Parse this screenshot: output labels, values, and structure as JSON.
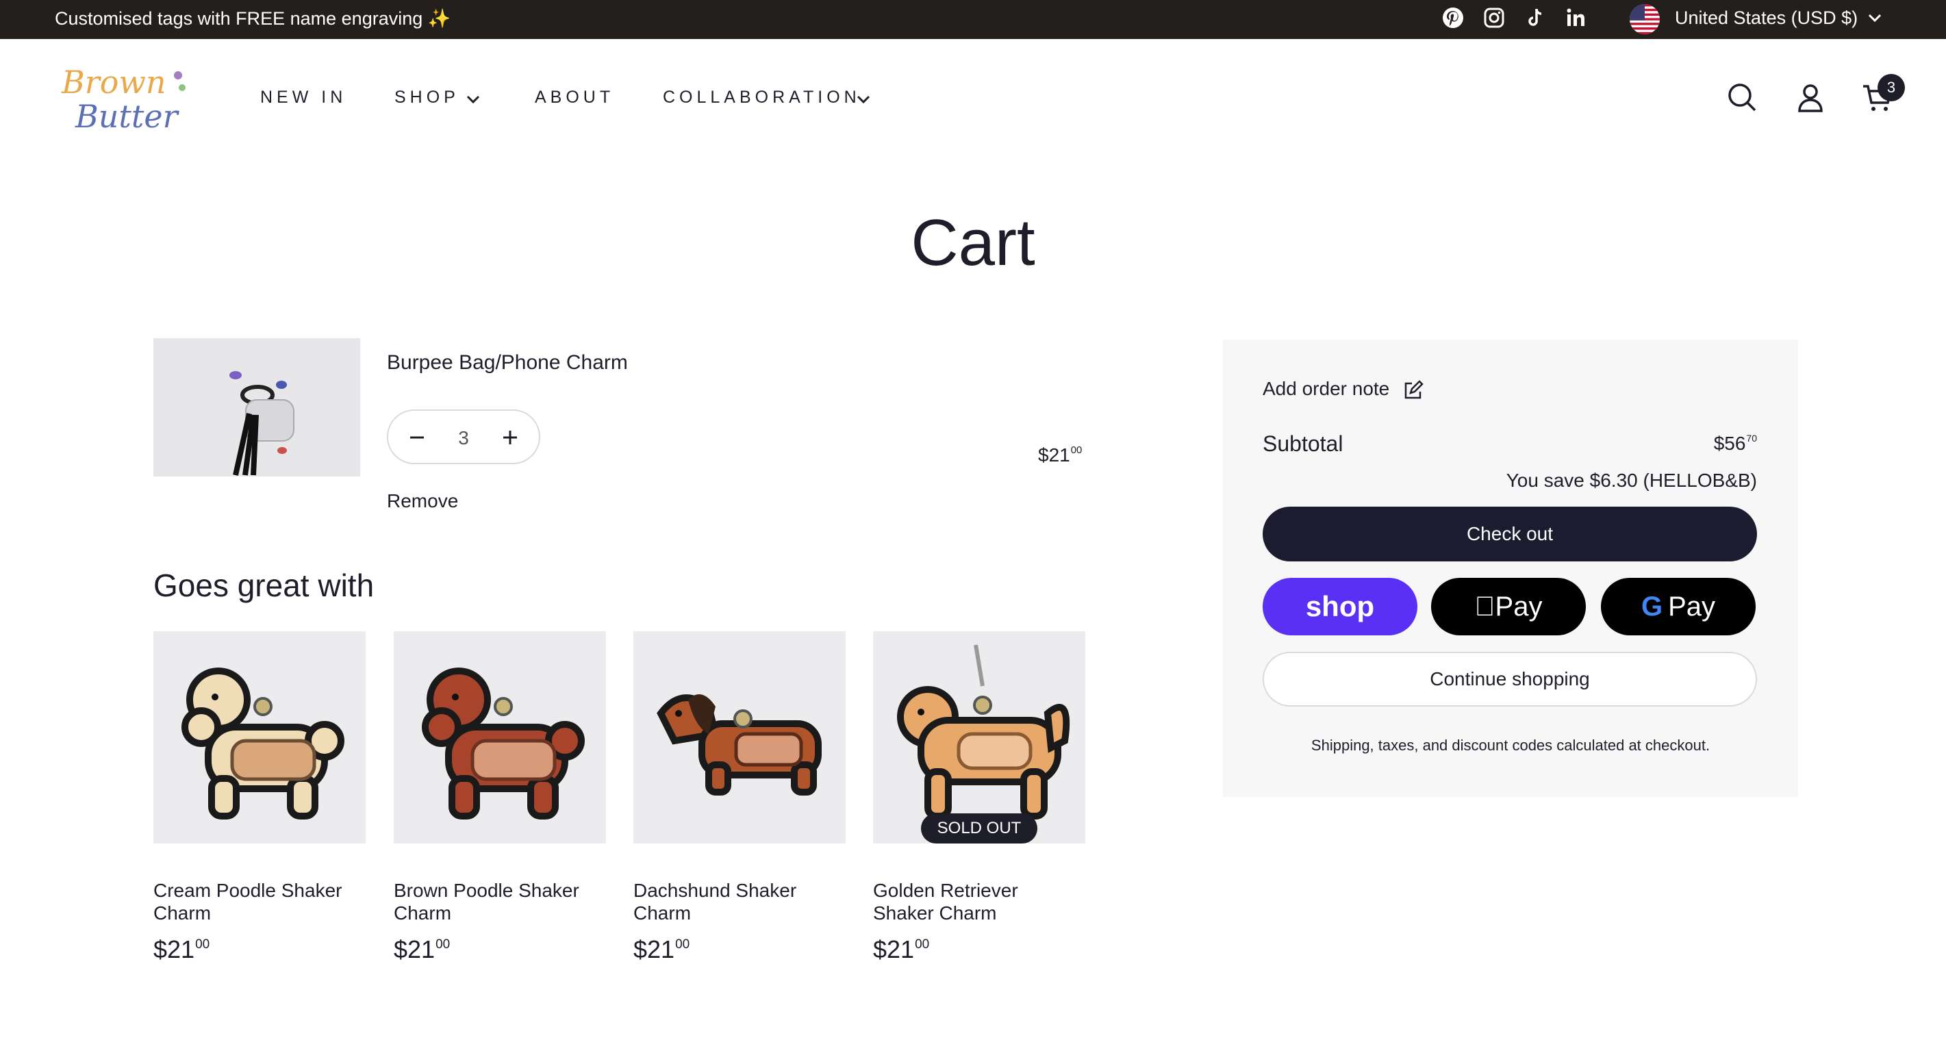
{
  "announcement": {
    "message": "Customised tags with FREE name engraving ✨",
    "social": [
      "pinterest-icon",
      "instagram-icon",
      "tiktok-icon",
      "linkedin-icon"
    ],
    "currency": "United States (USD $)"
  },
  "brand": {
    "logo_text_line1": "Brown",
    "logo_text_line2": "Butter"
  },
  "nav": {
    "items": [
      {
        "label": "NEW IN"
      },
      {
        "label": "SHOP"
      },
      {
        "label": "ABOUT"
      },
      {
        "label": "COLLABORATION"
      }
    ]
  },
  "header": {
    "cart_count": "3"
  },
  "page": {
    "title": "Cart"
  },
  "cart": {
    "line": {
      "title": "Burpee Bag/Phone Charm",
      "quantity": "3",
      "remove_label": "Remove",
      "price_main": "$21",
      "price_cents": "00"
    }
  },
  "recommendations": {
    "title": "Goes great with",
    "items": [
      {
        "name": "Cream Poodle Shaker Charm",
        "price_main": "$21",
        "price_cents": "00",
        "badge": ""
      },
      {
        "name": "Brown Poodle Shaker Charm",
        "price_main": "$21",
        "price_cents": "00",
        "badge": ""
      },
      {
        "name": "Dachshund Shaker Charm",
        "price_main": "$21",
        "price_cents": "00",
        "badge": ""
      },
      {
        "name": "Golden Retriever Shaker Charm",
        "price_main": "$21",
        "price_cents": "00",
        "badge": "SOLD OUT"
      }
    ]
  },
  "summary": {
    "note_label": "Add order note",
    "subtotal_label": "Subtotal",
    "subtotal_main": "$56",
    "subtotal_cents": "70",
    "savings": "You save $6.30 (HELLOB&B)",
    "checkout_label": "Check out",
    "shop_pay": "shop",
    "apple_pay": "Pay",
    "google_pay": "Pay",
    "continue_label": "Continue shopping",
    "shipping_note": "Shipping, taxes, and discount codes calculated at checkout."
  },
  "colors": {
    "announce_bg": "#231f1c",
    "checkout_bg": "#1c1c30",
    "shop_pay_bg": "#5a31f4",
    "summary_bg": "#f7f7f7"
  }
}
